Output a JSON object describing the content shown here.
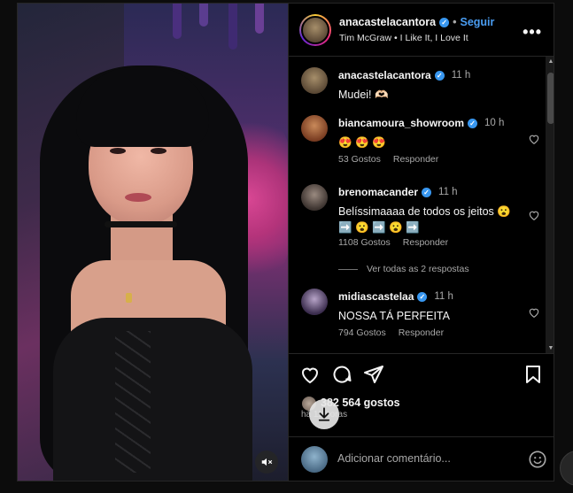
{
  "post": {
    "username": "anacastelacantora",
    "follow_label": "Seguir",
    "audio": "Tim McGraw • I Like It, I Love It",
    "more_label": "•••"
  },
  "caption": {
    "username": "anacastelacantora",
    "time": "11 h",
    "text": "Mudei! 🫶🏻"
  },
  "comments": [
    {
      "username": "biancamoura_showroom",
      "time": "10 h",
      "text": "😍 😍 😍",
      "likes": "53 Gostos",
      "reply_label": "Responder"
    },
    {
      "username": "brenomacander",
      "time": "11 h",
      "text": "Belíssimaaaa de todos os jeitos 😮 ➡️ 😮 ➡️ 😮 ➡️",
      "likes": "1108 Gostos",
      "reply_label": "Responder",
      "view_replies": "Ver todas as 2 respostas"
    },
    {
      "username": "midiascastelaa",
      "time": "11 h",
      "text": "NOSSA TÁ PERFEITA",
      "likes": "794 Gostos",
      "reply_label": "Responder"
    }
  ],
  "engagement": {
    "likes": "382 564 gostos",
    "posted": "há 11 horas"
  },
  "composer": {
    "placeholder": "Adicionar comentário..."
  },
  "icons": {
    "verified": "verified-badge-icon",
    "more": "more-options-icon",
    "like": "heart-icon",
    "comment": "comment-bubble-icon",
    "share": "paper-plane-icon",
    "save": "bookmark-icon",
    "mute": "muted-speaker-icon",
    "download": "download-arrow-icon",
    "emoji": "smiley-icon"
  },
  "colors": {
    "follow": "#4a9df2",
    "verified": "#3897f0",
    "muted_text": "#a8a8a8"
  }
}
